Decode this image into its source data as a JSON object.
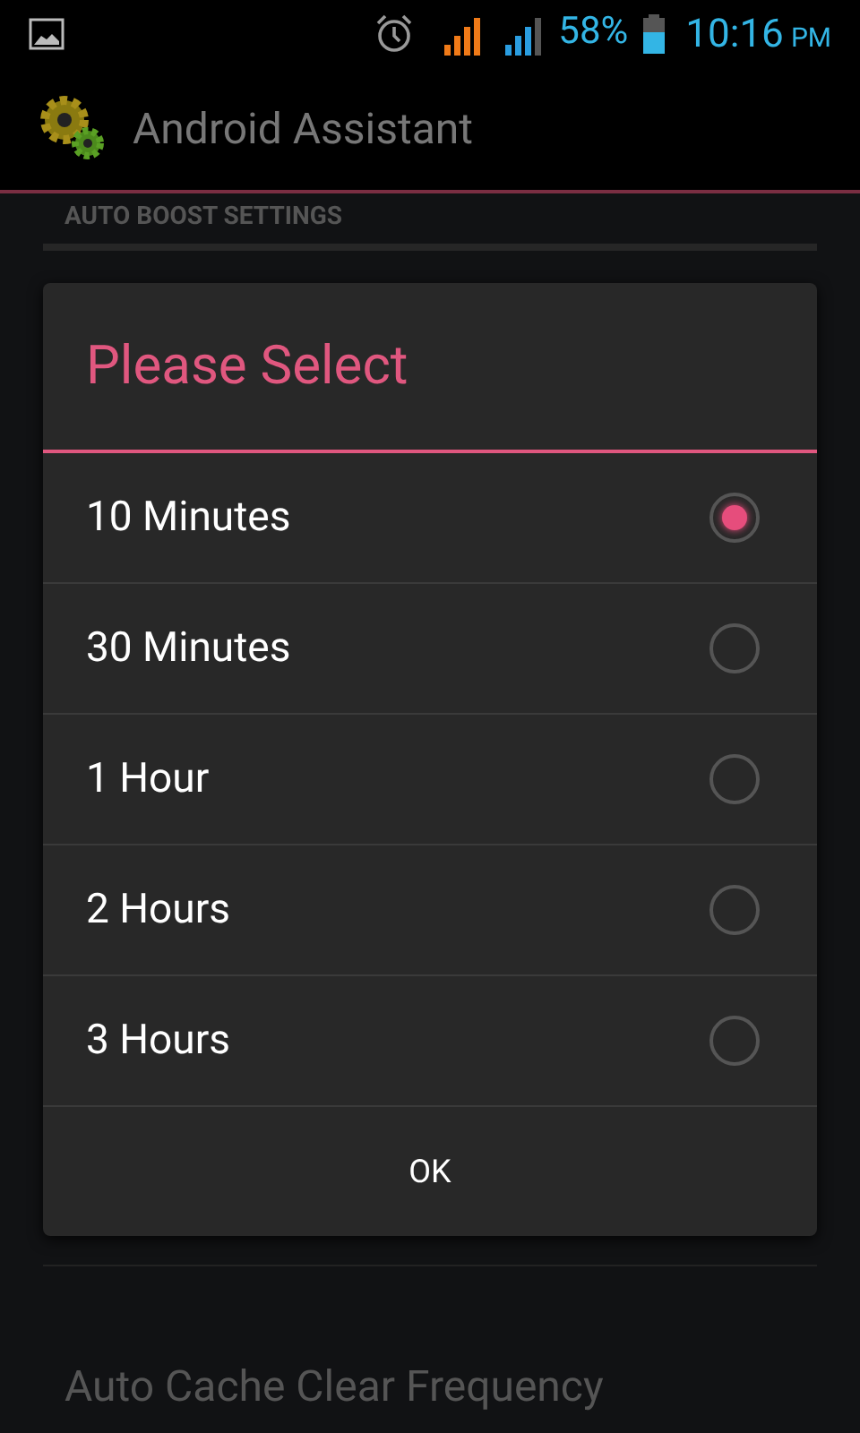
{
  "status_bar": {
    "battery": "58%",
    "time": "10:16",
    "meridiem": "PM"
  },
  "app_bar": {
    "title": "Android Assistant"
  },
  "section_header": "AUTO BOOST SETTINGS",
  "dialog": {
    "title": "Please Select",
    "options": [
      {
        "label": "10 Minutes",
        "selected": true
      },
      {
        "label": "30 Minutes",
        "selected": false
      },
      {
        "label": "1 Hour",
        "selected": false
      },
      {
        "label": "2 Hours",
        "selected": false
      },
      {
        "label": "3 Hours",
        "selected": false
      }
    ],
    "button": "OK"
  },
  "setting": "Auto Cache Clear Frequency"
}
